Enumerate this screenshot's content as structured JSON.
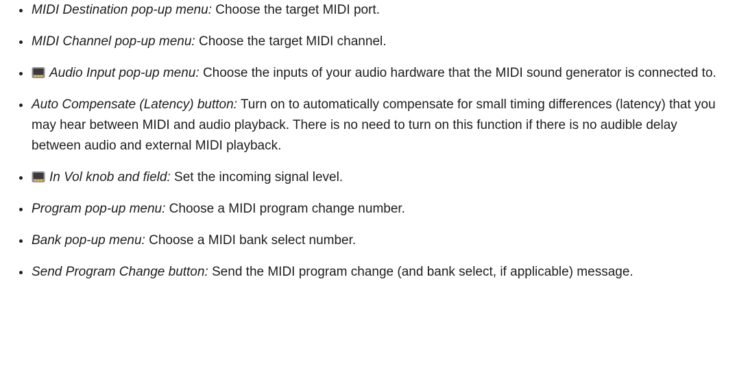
{
  "items": [
    {
      "term": "MIDI Destination pop-up menu:",
      "desc": " Choose the target MIDI port.",
      "icon": null
    },
    {
      "term": "MIDI Channel pop-up menu:",
      "desc": " Choose the target MIDI channel.",
      "icon": null
    },
    {
      "term": "Audio Input pop-up menu:",
      "desc": " Choose the inputs of your audio hardware that the MIDI sound generator is connected to.",
      "icon": "advanced-tools-icon"
    },
    {
      "term": "Auto Compensate (Latency) button:",
      "desc": " Turn on to automatically compensate for small timing differences (latency) that you may hear between MIDI and audio playback. There is no need to turn on this function if there is no audible delay between audio and external MIDI playback.",
      "icon": null
    },
    {
      "term": "In Vol knob and field:",
      "desc": " Set the incoming signal level.",
      "icon": "advanced-tools-icon"
    },
    {
      "term": "Program pop-up menu:",
      "desc": " Choose a MIDI program change number.",
      "icon": null
    },
    {
      "term": "Bank pop-up menu:",
      "desc": " Choose a MIDI bank select number.",
      "icon": null
    },
    {
      "term": "Send Program Change button:",
      "desc": " Send the MIDI program change (and bank select, if applicable) message.",
      "icon": null
    }
  ],
  "colors": {
    "text": "#1d1d1f",
    "icon_body": "#8e8e93",
    "icon_screen": "#3a3a3c",
    "icon_accent": "#ffcc00"
  }
}
